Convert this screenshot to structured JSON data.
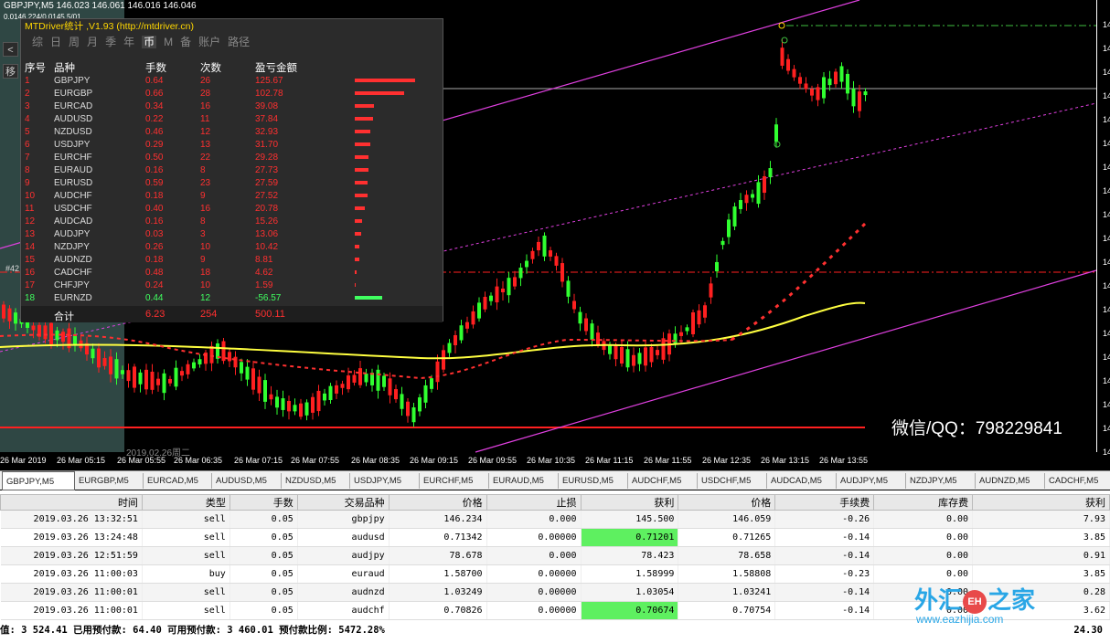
{
  "chart": {
    "title": "GBPJPY,M5  146.023 146.061 146.016 146.046",
    "subtitle": "0.0146.224/0.0145.5/01",
    "label_44": "#42",
    "side_buttons": [
      "<",
      "移"
    ],
    "wechat": "微信/QQ：798229841",
    "date_label": "2019.02.26周二",
    "time_labels": [
      "26 Mar 2019",
      "26 Mar 05:15",
      "26 Mar 05:55",
      "26 Mar 06:35",
      "26 Mar 07:15",
      "26 Mar 07:55",
      "26 Mar 08:35",
      "26 Mar 09:15",
      "26 Mar 09:55",
      "26 Mar 10:35",
      "26 Mar 11:15",
      "26 Mar 11:55",
      "26 Mar 12:35",
      "26 Mar 13:15",
      "26 Mar 13:55"
    ],
    "price_labels": [
      "14",
      "14",
      "14",
      "14",
      "14",
      "14",
      "14",
      "14",
      "14",
      "14",
      "14",
      "14",
      "14",
      "14",
      "14",
      "14",
      "14",
      "14",
      "14"
    ]
  },
  "stats_panel": {
    "title": "MTDriver统计 ,V1.93 (http://mtdriver.cn)",
    "tabs": [
      "综",
      "日",
      "周",
      "月",
      "季",
      "年",
      "币",
      "M",
      "备",
      "账户",
      "路径"
    ],
    "active_tab": "币",
    "headers": {
      "idx": "序号",
      "sym": "品种",
      "lots": "手数",
      "count": "次数",
      "pl": "盈亏金额"
    },
    "rows": [
      {
        "idx": "1",
        "sym": "GBPJPY",
        "lots": "0.64",
        "count": "26",
        "pl": "125.67",
        "value": 125.67
      },
      {
        "idx": "2",
        "sym": "EURGBP",
        "lots": "0.66",
        "count": "28",
        "pl": "102.78",
        "value": 102.78
      },
      {
        "idx": "3",
        "sym": "EURCAD",
        "lots": "0.34",
        "count": "16",
        "pl": "39.08",
        "value": 39.08
      },
      {
        "idx": "4",
        "sym": "AUDUSD",
        "lots": "0.22",
        "count": "11",
        "pl": "37.84",
        "value": 37.84
      },
      {
        "idx": "5",
        "sym": "NZDUSD",
        "lots": "0.46",
        "count": "12",
        "pl": "32.93",
        "value": 32.93
      },
      {
        "idx": "6",
        "sym": "USDJPY",
        "lots": "0.29",
        "count": "13",
        "pl": "31.70",
        "value": 31.7
      },
      {
        "idx": "7",
        "sym": "EURCHF",
        "lots": "0.50",
        "count": "22",
        "pl": "29.28",
        "value": 29.28
      },
      {
        "idx": "8",
        "sym": "EURAUD",
        "lots": "0.16",
        "count": "8",
        "pl": "27.73",
        "value": 27.73
      },
      {
        "idx": "9",
        "sym": "EURUSD",
        "lots": "0.59",
        "count": "23",
        "pl": "27.59",
        "value": 27.59
      },
      {
        "idx": "10",
        "sym": "AUDCHF",
        "lots": "0.18",
        "count": "9",
        "pl": "27.52",
        "value": 27.52
      },
      {
        "idx": "11",
        "sym": "USDCHF",
        "lots": "0.40",
        "count": "16",
        "pl": "20.78",
        "value": 20.78
      },
      {
        "idx": "12",
        "sym": "AUDCAD",
        "lots": "0.16",
        "count": "8",
        "pl": "15.26",
        "value": 15.26
      },
      {
        "idx": "13",
        "sym": "AUDJPY",
        "lots": "0.03",
        "count": "3",
        "pl": "13.06",
        "value": 13.06
      },
      {
        "idx": "14",
        "sym": "NZDJPY",
        "lots": "0.26",
        "count": "10",
        "pl": "10.42",
        "value": 10.42
      },
      {
        "idx": "15",
        "sym": "AUDNZD",
        "lots": "0.18",
        "count": "9",
        "pl": "8.81",
        "value": 8.81
      },
      {
        "idx": "16",
        "sym": "CADCHF",
        "lots": "0.48",
        "count": "18",
        "pl": "4.62",
        "value": 4.62
      },
      {
        "idx": "17",
        "sym": "CHFJPY",
        "lots": "0.24",
        "count": "10",
        "pl": "1.59",
        "value": 1.59
      },
      {
        "idx": "18",
        "sym": "EURNZD",
        "lots": "0.44",
        "count": "12",
        "pl": "-56.57",
        "value": -56.57
      }
    ],
    "total": {
      "label": "合计",
      "lots": "6.23",
      "count": "254",
      "pl": "500.11"
    },
    "colors": {
      "profit": "#ff3030",
      "loss": "#40ff60"
    }
  },
  "symbol_tabs": [
    "GBPJPY,M5",
    "EURGBP,M5",
    "EURCAD,M5",
    "AUDUSD,M5",
    "NZDUSD,M5",
    "USDJPY,M5",
    "EURCHF,M5",
    "EURAUD,M5",
    "EURUSD,M5",
    "AUDCHF,M5",
    "USDCHF,M5",
    "AUDCAD,M5",
    "AUDJPY,M5",
    "NZDJPY,M5",
    "AUDNZD,M5",
    "CADCHF,M5"
  ],
  "active_symbol_tab": "GBPJPY,M5",
  "orders": {
    "columns": [
      "时间",
      "类型",
      "手数",
      "交易品种",
      "价格",
      "止损",
      "获利",
      "价格",
      "手续费",
      "库存费",
      "获利"
    ],
    "rows": [
      [
        "2019.03.26 13:32:51",
        "sell",
        "0.05",
        "gbpjpy",
        "146.234",
        "0.000",
        "145.500",
        "146.059",
        "-0.26",
        "0.00",
        "7.93"
      ],
      [
        "2019.03.26 13:24:48",
        "sell",
        "0.05",
        "audusd",
        "0.71342",
        "0.00000",
        "0.71201",
        "0.71265",
        "-0.14",
        "0.00",
        "3.85"
      ],
      [
        "2019.03.26 12:51:59",
        "sell",
        "0.05",
        "audjpy",
        "78.678",
        "0.000",
        "78.423",
        "78.658",
        "-0.14",
        "0.00",
        "0.91"
      ],
      [
        "2019.03.26 11:00:03",
        "buy",
        "0.05",
        "euraud",
        "1.58700",
        "0.00000",
        "1.58999",
        "1.58808",
        "-0.23",
        "0.00",
        "3.85"
      ],
      [
        "2019.03.26 11:00:01",
        "sell",
        "0.05",
        "audnzd",
        "1.03249",
        "0.00000",
        "1.03054",
        "1.03241",
        "-0.14",
        "0.00",
        "0.28"
      ],
      [
        "2019.03.26 11:00:01",
        "sell",
        "0.05",
        "audchf",
        "0.70826",
        "0.00000",
        "0.70674",
        "0.70754",
        "-0.14",
        "0.00",
        "3.62"
      ]
    ],
    "highlight_tp_rows": [
      1,
      5
    ],
    "highlight_color": "#5ef060"
  },
  "status": {
    "text": "值: 3 524.41   已用预付款: 64.40   可用预付款: 3 460.01   预付款比例: 5472.28%",
    "right": "24.30"
  },
  "watermark": {
    "cn": "外汇之家",
    "seal": "EH",
    "url": "www.eazhijia.com"
  }
}
